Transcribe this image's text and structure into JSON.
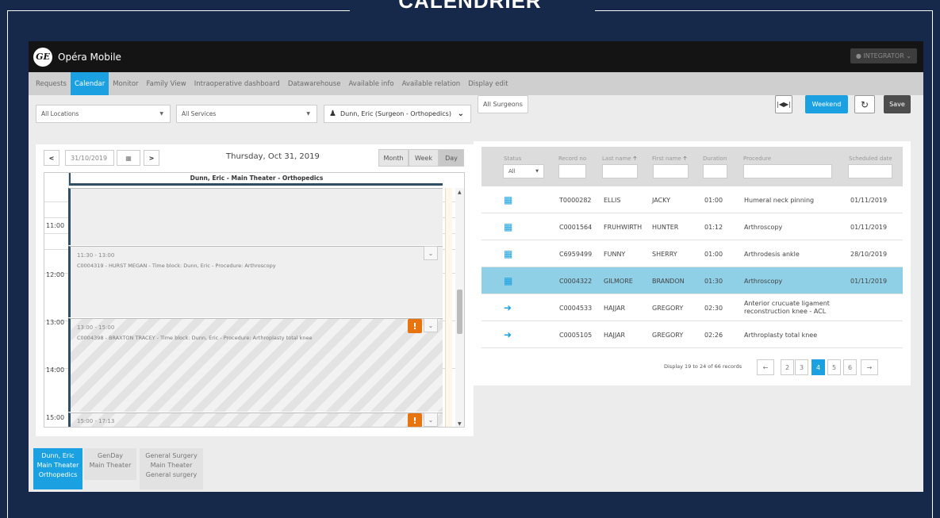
{
  "slide_title": "CALENDRIER",
  "topbar": {
    "logo": "GE",
    "title": "Opéra Mobile",
    "user": "INTEGRATOR"
  },
  "nav": {
    "items": [
      "Requests",
      "Calendar",
      "Monitor",
      "Family View",
      "Intraoperative dashboard",
      "Datawarehouse",
      "Available info",
      "Available relation",
      "Display edit"
    ],
    "active": "Calendar"
  },
  "filters": {
    "location": "All Locations",
    "service": "All Services",
    "surgeon": "Dunn, Eric (Surgeon - Orthopedics)",
    "all_surgeons": "All Surgeons",
    "weekend": "Weekend",
    "save": "Save"
  },
  "calendar": {
    "date_input": "31/10/2019",
    "day_title": "Thursday, Oct 31, 2019",
    "views": [
      "Month",
      "Week",
      "Day"
    ],
    "active_view": "Day",
    "column_header": "Dunn, Eric - Main Theater - Orthopedics",
    "time_labels": [
      "11:00",
      "12:00",
      "13:00",
      "14:00",
      "15:00"
    ],
    "blocks": [
      {
        "time": "11:30 - 13:00",
        "desc": "C0004319 - HURST MEGAN - Time block: Dunn, Eric - Procedure: Arthroscopy"
      },
      {
        "time": "13:00 - 15:00",
        "desc": "C0004398 - BRAXTON TRACEY - Time block: Dunn, Eric - Procedure: Arthroplasty total knee"
      },
      {
        "time": "15:00 - 17:13",
        "desc": ""
      }
    ]
  },
  "table": {
    "headers": {
      "status": "Status",
      "record_no": "Record no",
      "last_name": "Last name",
      "first_name": "First name",
      "duration": "Duration",
      "procedure": "Procedure",
      "scheduled_date": "Scheduled date"
    },
    "status_filter": "All",
    "rows": [
      {
        "icon": "calendar-clock-icon",
        "record": "T0000282",
        "last": "ELLIS",
        "first": "JACKY",
        "duration": "01:00",
        "procedure": "Humeral neck pinning",
        "date": "01/11/2019",
        "selected": false
      },
      {
        "icon": "calendar-clock-icon",
        "record": "C0001564",
        "last": "FRUHWIRTH",
        "first": "HUNTER",
        "duration": "01:12",
        "procedure": "Arthroscopy",
        "date": "01/11/2019",
        "selected": false
      },
      {
        "icon": "calendar-clock-icon",
        "record": "C6959499",
        "last": "FUNNY",
        "first": "SHERRY",
        "duration": "01:00",
        "procedure": "Arthrodesis ankle",
        "date": "28/10/2019",
        "selected": false
      },
      {
        "icon": "calendar-clock-icon",
        "record": "C0004322",
        "last": "GILMORE",
        "first": "BRANDON",
        "duration": "01:30",
        "procedure": "Arthroscopy",
        "date": "01/11/2019",
        "selected": true
      },
      {
        "icon": "calendar-arrow-icon",
        "record": "C0004533",
        "last": "HAJJAR",
        "first": "GREGORY",
        "duration": "02:30",
        "procedure": "Anterior crucuate ligament reconstruction knee - ACL",
        "date": "",
        "selected": false
      },
      {
        "icon": "calendar-arrow-icon",
        "record": "C0005105",
        "last": "HAJJAR",
        "first": "GREGORY",
        "duration": "02:26",
        "procedure": "Arthroplasty total knee",
        "date": "",
        "selected": false
      }
    ],
    "pagination": {
      "summary": "Display 19 to 24 of 66 records",
      "pages": [
        "2",
        "3",
        "4",
        "5",
        "6"
      ],
      "active": "4",
      "prev": "←",
      "next": "→"
    }
  },
  "room_tabs": [
    {
      "line1": "Dunn, Eric",
      "line2": "Main Theater",
      "line3": "Orthopedics",
      "active": true
    },
    {
      "line1": "GenDay",
      "line2": "Main Theater",
      "line3": "",
      "active": false
    },
    {
      "line1": "General Surgery",
      "line2": "Main Theater",
      "line3": "General surgery",
      "active": false
    }
  ],
  "colors": {
    "navy": "#17294a",
    "accent": "#1ba1e2",
    "warning": "#e8740f",
    "selected_row": "#8fd0e6"
  }
}
